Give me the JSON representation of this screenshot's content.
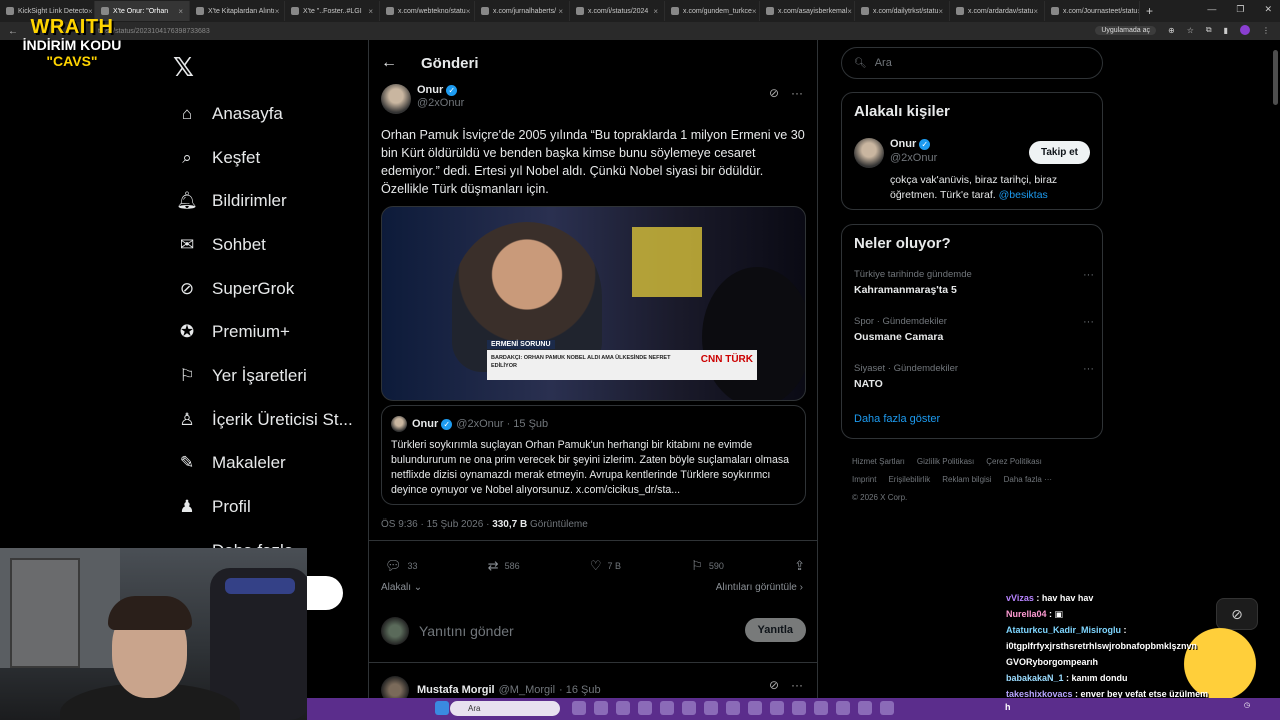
{
  "browser": {
    "tabs": [
      {
        "label": "KickSight Link Detecto",
        "active": false
      },
      {
        "label": "X'te Onur: \"Orhan",
        "active": true
      },
      {
        "label": "X'te Kitaplardan Alıntı",
        "active": false
      },
      {
        "label": "X'te \"..Foster..#LGI",
        "active": false
      },
      {
        "label": "x.com/webtekno/statu",
        "active": false
      },
      {
        "label": "x.com/jurnalhaberts/",
        "active": false
      },
      {
        "label": "x.com/i/status/2024",
        "active": false
      },
      {
        "label": "x.com/gundem_turkce",
        "active": false
      },
      {
        "label": "x.com/asayisberkemal",
        "active": false
      },
      {
        "label": "x.com/dailytrkst/statu",
        "active": false
      },
      {
        "label": "x.com/ardardav/statu",
        "active": false
      },
      {
        "label": "x.com/Journasteet/statu",
        "active": false
      }
    ],
    "url": "ttps://status/2023104176398733683",
    "app_pill": "Uygulamada aç"
  },
  "overlay_logo": {
    "line1": "WRAITH",
    "line2": "İNDİRİM KODU",
    "line3": "\"CAVS\""
  },
  "sidebar": {
    "items": [
      {
        "label": "Anasayfa",
        "icon": "home-icon"
      },
      {
        "label": "Keşfet",
        "icon": "search-icon"
      },
      {
        "label": "Bildirimler",
        "icon": "bell-icon"
      },
      {
        "label": "Sohbet",
        "icon": "mail-icon"
      },
      {
        "label": "SuperGrok",
        "icon": "grok-icon"
      },
      {
        "label": "Premium+",
        "icon": "verified-icon"
      },
      {
        "label": "Yer İşaretleri",
        "icon": "bookmark-icon"
      },
      {
        "label": "İçerik Üreticisi St...",
        "icon": "creator-icon"
      },
      {
        "label": "Makaleler",
        "icon": "article-icon"
      },
      {
        "label": "Profil",
        "icon": "profile-icon"
      },
      {
        "label": "Daha fazla",
        "icon": "more-icon"
      }
    ]
  },
  "post": {
    "header_title": "Gönderi",
    "author_name": "Onur",
    "author_handle": "@2xOnur",
    "text": "Orhan Pamuk İsviçre'de 2005 yılında “Bu topraklarda 1 milyon Ermeni ve 30 bin Kürt öldürüldü ve benden başka kimse bunu söylemeye cesaret edemiyor.” dedi. Ertesi yıl Nobel aldı. Çünkü Nobel siyasi bir ödüldür. Özellikle Türk düşmanları için.",
    "media": {
      "tag": "ERMENİ SORUNU",
      "caption": "BARDAKÇI: ORHAN PAMUK NOBEL ALDI AMA ÜLKESİNDE NEFRET EDİLİYOR",
      "channel": "CNN TÜRK"
    },
    "quote": {
      "name": "Onur",
      "meta": "@2xOnur · 15 Şub",
      "text": "Türkleri soykırımla suçlayan Orhan Pamuk'un herhangi bir kitabını ne evimde bulundururum ne ona prim verecek bir şeyini izlerim. Zaten böyle suçlamaları olmasa netflixde dizisi oynamazdı merak etmeyin. Avrupa kentlerinde Türklere soykırımcı deyince oynuyor ve Nobel alıyorsunuz. x.com/cicikus_dr/sta..."
    },
    "time": "ÖS 9:36 · 15 Şub 2026 · ",
    "views": "330,7 B",
    "views_label": " Görüntüleme",
    "actions": {
      "replies": "33",
      "reposts": "586",
      "likes": "7 B",
      "bookmarks": "590"
    },
    "relevance": "Alakalı",
    "view_quotes": "Alıntıları görüntüle",
    "reply_placeholder": "Yanıtını gönder",
    "reply_button": "Yanıtla",
    "next_post": {
      "name": "Mustafa Morgil",
      "handle": "@M_Morgil",
      "date": "· 16 Şub"
    }
  },
  "right": {
    "search_placeholder": "Ara",
    "related_title": "Alakalı kişiler",
    "related": {
      "name": "Onur",
      "handle": "@2xOnur",
      "follow": "Takip et",
      "bio": "çokça vak'anüvis, biraz tarihçi, biraz öğretmen. Türk'e taraf. ",
      "bio_link": "@besiktas"
    },
    "trends_title": "Neler oluyor?",
    "trends": [
      {
        "category": "Türkiye tarihinde gündemde",
        "title": "Kahramanmaraş'ta 5"
      },
      {
        "category": "Spor · Gündemdekiler",
        "title": "Ousmane Camara"
      },
      {
        "category": "Siyaset · Gündemdekiler",
        "title": "NATO"
      }
    ],
    "show_more": "Daha fazla göster",
    "footer": [
      "Hizmet Şartları",
      "Gizlilik Politikası",
      "Çerez Politikası",
      "Imprint",
      "Erişilebilirlik",
      "Reklam bilgisi",
      "Daha fazla ···",
      "© 2026 X Corp."
    ]
  },
  "chat": [
    {
      "user": "vVizas",
      "msg": " : hav hav hav"
    },
    {
      "user": "Nurella04",
      "msg": " : ▣"
    },
    {
      "user": "Ataturkcu_Kadir_Misiroglu",
      "msg": " :"
    },
    {
      "user": "",
      "msg": "i0tgplfrfyxjrsthsretrhlswjrobnafopbmklşznvn GVORyborgompearıh"
    },
    {
      "user": "babakakaN_1",
      "msg": " : kanım dondu"
    },
    {
      "user": "takeshixkovacs",
      "msg": " : enver bey vefat etse üzülmem"
    }
  ],
  "taskbar": {
    "search": "Ara",
    "h": "h"
  }
}
